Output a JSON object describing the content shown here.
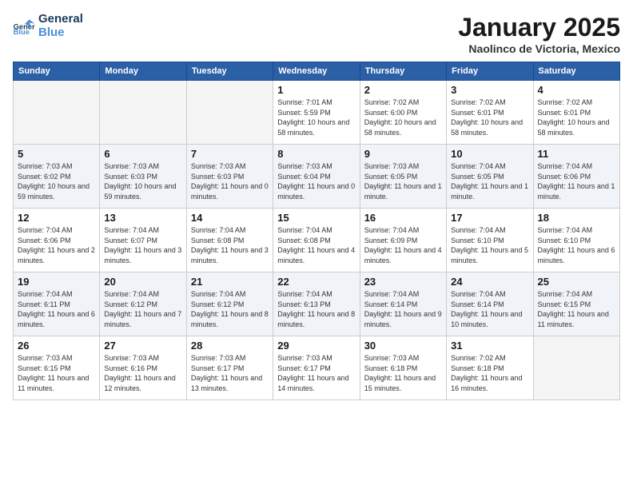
{
  "header": {
    "logo": {
      "general": "General",
      "blue": "Blue"
    },
    "title": "January 2025",
    "location": "Naolinco de Victoria, Mexico"
  },
  "days_of_week": [
    "Sunday",
    "Monday",
    "Tuesday",
    "Wednesday",
    "Thursday",
    "Friday",
    "Saturday"
  ],
  "weeks": [
    {
      "days": [
        {
          "num": "",
          "empty": true
        },
        {
          "num": "",
          "empty": true
        },
        {
          "num": "",
          "empty": true
        },
        {
          "num": "1",
          "sunrise": "7:01 AM",
          "sunset": "5:59 PM",
          "daylight": "10 hours and 58 minutes."
        },
        {
          "num": "2",
          "sunrise": "7:02 AM",
          "sunset": "6:00 PM",
          "daylight": "10 hours and 58 minutes."
        },
        {
          "num": "3",
          "sunrise": "7:02 AM",
          "sunset": "6:01 PM",
          "daylight": "10 hours and 58 minutes."
        },
        {
          "num": "4",
          "sunrise": "7:02 AM",
          "sunset": "6:01 PM",
          "daylight": "10 hours and 58 minutes."
        }
      ]
    },
    {
      "days": [
        {
          "num": "5",
          "sunrise": "7:03 AM",
          "sunset": "6:02 PM",
          "daylight": "10 hours and 59 minutes."
        },
        {
          "num": "6",
          "sunrise": "7:03 AM",
          "sunset": "6:03 PM",
          "daylight": "10 hours and 59 minutes."
        },
        {
          "num": "7",
          "sunrise": "7:03 AM",
          "sunset": "6:03 PM",
          "daylight": "11 hours and 0 minutes."
        },
        {
          "num": "8",
          "sunrise": "7:03 AM",
          "sunset": "6:04 PM",
          "daylight": "11 hours and 0 minutes."
        },
        {
          "num": "9",
          "sunrise": "7:03 AM",
          "sunset": "6:05 PM",
          "daylight": "11 hours and 1 minute."
        },
        {
          "num": "10",
          "sunrise": "7:04 AM",
          "sunset": "6:05 PM",
          "daylight": "11 hours and 1 minute."
        },
        {
          "num": "11",
          "sunrise": "7:04 AM",
          "sunset": "6:06 PM",
          "daylight": "11 hours and 1 minute."
        }
      ]
    },
    {
      "days": [
        {
          "num": "12",
          "sunrise": "7:04 AM",
          "sunset": "6:06 PM",
          "daylight": "11 hours and 2 minutes."
        },
        {
          "num": "13",
          "sunrise": "7:04 AM",
          "sunset": "6:07 PM",
          "daylight": "11 hours and 3 minutes."
        },
        {
          "num": "14",
          "sunrise": "7:04 AM",
          "sunset": "6:08 PM",
          "daylight": "11 hours and 3 minutes."
        },
        {
          "num": "15",
          "sunrise": "7:04 AM",
          "sunset": "6:08 PM",
          "daylight": "11 hours and 4 minutes."
        },
        {
          "num": "16",
          "sunrise": "7:04 AM",
          "sunset": "6:09 PM",
          "daylight": "11 hours and 4 minutes."
        },
        {
          "num": "17",
          "sunrise": "7:04 AM",
          "sunset": "6:10 PM",
          "daylight": "11 hours and 5 minutes."
        },
        {
          "num": "18",
          "sunrise": "7:04 AM",
          "sunset": "6:10 PM",
          "daylight": "11 hours and 6 minutes."
        }
      ]
    },
    {
      "days": [
        {
          "num": "19",
          "sunrise": "7:04 AM",
          "sunset": "6:11 PM",
          "daylight": "11 hours and 6 minutes."
        },
        {
          "num": "20",
          "sunrise": "7:04 AM",
          "sunset": "6:12 PM",
          "daylight": "11 hours and 7 minutes."
        },
        {
          "num": "21",
          "sunrise": "7:04 AM",
          "sunset": "6:12 PM",
          "daylight": "11 hours and 8 minutes."
        },
        {
          "num": "22",
          "sunrise": "7:04 AM",
          "sunset": "6:13 PM",
          "daylight": "11 hours and 8 minutes."
        },
        {
          "num": "23",
          "sunrise": "7:04 AM",
          "sunset": "6:14 PM",
          "daylight": "11 hours and 9 minutes."
        },
        {
          "num": "24",
          "sunrise": "7:04 AM",
          "sunset": "6:14 PM",
          "daylight": "11 hours and 10 minutes."
        },
        {
          "num": "25",
          "sunrise": "7:04 AM",
          "sunset": "6:15 PM",
          "daylight": "11 hours and 11 minutes."
        }
      ]
    },
    {
      "days": [
        {
          "num": "26",
          "sunrise": "7:03 AM",
          "sunset": "6:15 PM",
          "daylight": "11 hours and 11 minutes."
        },
        {
          "num": "27",
          "sunrise": "7:03 AM",
          "sunset": "6:16 PM",
          "daylight": "11 hours and 12 minutes."
        },
        {
          "num": "28",
          "sunrise": "7:03 AM",
          "sunset": "6:17 PM",
          "daylight": "11 hours and 13 minutes."
        },
        {
          "num": "29",
          "sunrise": "7:03 AM",
          "sunset": "6:17 PM",
          "daylight": "11 hours and 14 minutes."
        },
        {
          "num": "30",
          "sunrise": "7:03 AM",
          "sunset": "6:18 PM",
          "daylight": "11 hours and 15 minutes."
        },
        {
          "num": "31",
          "sunrise": "7:02 AM",
          "sunset": "6:18 PM",
          "daylight": "11 hours and 16 minutes."
        },
        {
          "num": "",
          "empty": true
        }
      ]
    }
  ],
  "labels": {
    "sunrise": "Sunrise:",
    "sunset": "Sunset:",
    "daylight": "Daylight:"
  }
}
